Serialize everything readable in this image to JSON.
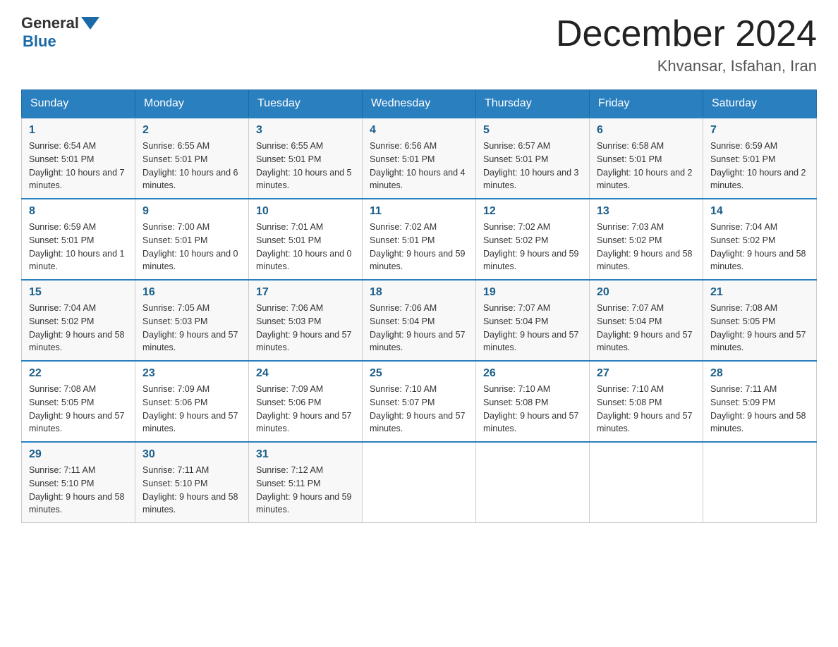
{
  "header": {
    "logo": {
      "general": "General",
      "blue": "Blue",
      "triangle_color": "#1a6aa8"
    },
    "title": "December 2024",
    "location": "Khvansar, Isfahan, Iran"
  },
  "calendar": {
    "days_of_week": [
      "Sunday",
      "Monday",
      "Tuesday",
      "Wednesday",
      "Thursday",
      "Friday",
      "Saturday"
    ],
    "weeks": [
      [
        {
          "day": "1",
          "sunrise": "6:54 AM",
          "sunset": "5:01 PM",
          "daylight": "10 hours and 7 minutes."
        },
        {
          "day": "2",
          "sunrise": "6:55 AM",
          "sunset": "5:01 PM",
          "daylight": "10 hours and 6 minutes."
        },
        {
          "day": "3",
          "sunrise": "6:55 AM",
          "sunset": "5:01 PM",
          "daylight": "10 hours and 5 minutes."
        },
        {
          "day": "4",
          "sunrise": "6:56 AM",
          "sunset": "5:01 PM",
          "daylight": "10 hours and 4 minutes."
        },
        {
          "day": "5",
          "sunrise": "6:57 AM",
          "sunset": "5:01 PM",
          "daylight": "10 hours and 3 minutes."
        },
        {
          "day": "6",
          "sunrise": "6:58 AM",
          "sunset": "5:01 PM",
          "daylight": "10 hours and 2 minutes."
        },
        {
          "day": "7",
          "sunrise": "6:59 AM",
          "sunset": "5:01 PM",
          "daylight": "10 hours and 2 minutes."
        }
      ],
      [
        {
          "day": "8",
          "sunrise": "6:59 AM",
          "sunset": "5:01 PM",
          "daylight": "10 hours and 1 minute."
        },
        {
          "day": "9",
          "sunrise": "7:00 AM",
          "sunset": "5:01 PM",
          "daylight": "10 hours and 0 minutes."
        },
        {
          "day": "10",
          "sunrise": "7:01 AM",
          "sunset": "5:01 PM",
          "daylight": "10 hours and 0 minutes."
        },
        {
          "day": "11",
          "sunrise": "7:02 AM",
          "sunset": "5:01 PM",
          "daylight": "9 hours and 59 minutes."
        },
        {
          "day": "12",
          "sunrise": "7:02 AM",
          "sunset": "5:02 PM",
          "daylight": "9 hours and 59 minutes."
        },
        {
          "day": "13",
          "sunrise": "7:03 AM",
          "sunset": "5:02 PM",
          "daylight": "9 hours and 58 minutes."
        },
        {
          "day": "14",
          "sunrise": "7:04 AM",
          "sunset": "5:02 PM",
          "daylight": "9 hours and 58 minutes."
        }
      ],
      [
        {
          "day": "15",
          "sunrise": "7:04 AM",
          "sunset": "5:02 PM",
          "daylight": "9 hours and 58 minutes."
        },
        {
          "day": "16",
          "sunrise": "7:05 AM",
          "sunset": "5:03 PM",
          "daylight": "9 hours and 57 minutes."
        },
        {
          "day": "17",
          "sunrise": "7:06 AM",
          "sunset": "5:03 PM",
          "daylight": "9 hours and 57 minutes."
        },
        {
          "day": "18",
          "sunrise": "7:06 AM",
          "sunset": "5:04 PM",
          "daylight": "9 hours and 57 minutes."
        },
        {
          "day": "19",
          "sunrise": "7:07 AM",
          "sunset": "5:04 PM",
          "daylight": "9 hours and 57 minutes."
        },
        {
          "day": "20",
          "sunrise": "7:07 AM",
          "sunset": "5:04 PM",
          "daylight": "9 hours and 57 minutes."
        },
        {
          "day": "21",
          "sunrise": "7:08 AM",
          "sunset": "5:05 PM",
          "daylight": "9 hours and 57 minutes."
        }
      ],
      [
        {
          "day": "22",
          "sunrise": "7:08 AM",
          "sunset": "5:05 PM",
          "daylight": "9 hours and 57 minutes."
        },
        {
          "day": "23",
          "sunrise": "7:09 AM",
          "sunset": "5:06 PM",
          "daylight": "9 hours and 57 minutes."
        },
        {
          "day": "24",
          "sunrise": "7:09 AM",
          "sunset": "5:06 PM",
          "daylight": "9 hours and 57 minutes."
        },
        {
          "day": "25",
          "sunrise": "7:10 AM",
          "sunset": "5:07 PM",
          "daylight": "9 hours and 57 minutes."
        },
        {
          "day": "26",
          "sunrise": "7:10 AM",
          "sunset": "5:08 PM",
          "daylight": "9 hours and 57 minutes."
        },
        {
          "day": "27",
          "sunrise": "7:10 AM",
          "sunset": "5:08 PM",
          "daylight": "9 hours and 57 minutes."
        },
        {
          "day": "28",
          "sunrise": "7:11 AM",
          "sunset": "5:09 PM",
          "daylight": "9 hours and 58 minutes."
        }
      ],
      [
        {
          "day": "29",
          "sunrise": "7:11 AM",
          "sunset": "5:10 PM",
          "daylight": "9 hours and 58 minutes."
        },
        {
          "day": "30",
          "sunrise": "7:11 AM",
          "sunset": "5:10 PM",
          "daylight": "9 hours and 58 minutes."
        },
        {
          "day": "31",
          "sunrise": "7:12 AM",
          "sunset": "5:11 PM",
          "daylight": "9 hours and 59 minutes."
        },
        null,
        null,
        null,
        null
      ]
    ],
    "labels": {
      "sunrise": "Sunrise:",
      "sunset": "Sunset:",
      "daylight": "Daylight:"
    }
  }
}
